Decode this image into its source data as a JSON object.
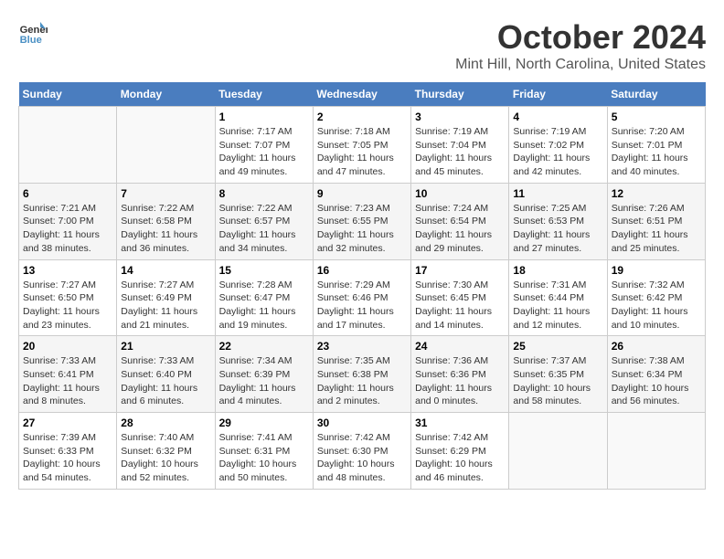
{
  "header": {
    "logo_line1": "General",
    "logo_line2": "Blue",
    "month": "October 2024",
    "location": "Mint Hill, North Carolina, United States"
  },
  "days_of_week": [
    "Sunday",
    "Monday",
    "Tuesday",
    "Wednesday",
    "Thursday",
    "Friday",
    "Saturday"
  ],
  "weeks": [
    [
      {
        "day": "",
        "sunrise": "",
        "sunset": "",
        "daylight": ""
      },
      {
        "day": "",
        "sunrise": "",
        "sunset": "",
        "daylight": ""
      },
      {
        "day": "1",
        "sunrise": "Sunrise: 7:17 AM",
        "sunset": "Sunset: 7:07 PM",
        "daylight": "Daylight: 11 hours and 49 minutes."
      },
      {
        "day": "2",
        "sunrise": "Sunrise: 7:18 AM",
        "sunset": "Sunset: 7:05 PM",
        "daylight": "Daylight: 11 hours and 47 minutes."
      },
      {
        "day": "3",
        "sunrise": "Sunrise: 7:19 AM",
        "sunset": "Sunset: 7:04 PM",
        "daylight": "Daylight: 11 hours and 45 minutes."
      },
      {
        "day": "4",
        "sunrise": "Sunrise: 7:19 AM",
        "sunset": "Sunset: 7:02 PM",
        "daylight": "Daylight: 11 hours and 42 minutes."
      },
      {
        "day": "5",
        "sunrise": "Sunrise: 7:20 AM",
        "sunset": "Sunset: 7:01 PM",
        "daylight": "Daylight: 11 hours and 40 minutes."
      }
    ],
    [
      {
        "day": "6",
        "sunrise": "Sunrise: 7:21 AM",
        "sunset": "Sunset: 7:00 PM",
        "daylight": "Daylight: 11 hours and 38 minutes."
      },
      {
        "day": "7",
        "sunrise": "Sunrise: 7:22 AM",
        "sunset": "Sunset: 6:58 PM",
        "daylight": "Daylight: 11 hours and 36 minutes."
      },
      {
        "day": "8",
        "sunrise": "Sunrise: 7:22 AM",
        "sunset": "Sunset: 6:57 PM",
        "daylight": "Daylight: 11 hours and 34 minutes."
      },
      {
        "day": "9",
        "sunrise": "Sunrise: 7:23 AM",
        "sunset": "Sunset: 6:55 PM",
        "daylight": "Daylight: 11 hours and 32 minutes."
      },
      {
        "day": "10",
        "sunrise": "Sunrise: 7:24 AM",
        "sunset": "Sunset: 6:54 PM",
        "daylight": "Daylight: 11 hours and 29 minutes."
      },
      {
        "day": "11",
        "sunrise": "Sunrise: 7:25 AM",
        "sunset": "Sunset: 6:53 PM",
        "daylight": "Daylight: 11 hours and 27 minutes."
      },
      {
        "day": "12",
        "sunrise": "Sunrise: 7:26 AM",
        "sunset": "Sunset: 6:51 PM",
        "daylight": "Daylight: 11 hours and 25 minutes."
      }
    ],
    [
      {
        "day": "13",
        "sunrise": "Sunrise: 7:27 AM",
        "sunset": "Sunset: 6:50 PM",
        "daylight": "Daylight: 11 hours and 23 minutes."
      },
      {
        "day": "14",
        "sunrise": "Sunrise: 7:27 AM",
        "sunset": "Sunset: 6:49 PM",
        "daylight": "Daylight: 11 hours and 21 minutes."
      },
      {
        "day": "15",
        "sunrise": "Sunrise: 7:28 AM",
        "sunset": "Sunset: 6:47 PM",
        "daylight": "Daylight: 11 hours and 19 minutes."
      },
      {
        "day": "16",
        "sunrise": "Sunrise: 7:29 AM",
        "sunset": "Sunset: 6:46 PM",
        "daylight": "Daylight: 11 hours and 17 minutes."
      },
      {
        "day": "17",
        "sunrise": "Sunrise: 7:30 AM",
        "sunset": "Sunset: 6:45 PM",
        "daylight": "Daylight: 11 hours and 14 minutes."
      },
      {
        "day": "18",
        "sunrise": "Sunrise: 7:31 AM",
        "sunset": "Sunset: 6:44 PM",
        "daylight": "Daylight: 11 hours and 12 minutes."
      },
      {
        "day": "19",
        "sunrise": "Sunrise: 7:32 AM",
        "sunset": "Sunset: 6:42 PM",
        "daylight": "Daylight: 11 hours and 10 minutes."
      }
    ],
    [
      {
        "day": "20",
        "sunrise": "Sunrise: 7:33 AM",
        "sunset": "Sunset: 6:41 PM",
        "daylight": "Daylight: 11 hours and 8 minutes."
      },
      {
        "day": "21",
        "sunrise": "Sunrise: 7:33 AM",
        "sunset": "Sunset: 6:40 PM",
        "daylight": "Daylight: 11 hours and 6 minutes."
      },
      {
        "day": "22",
        "sunrise": "Sunrise: 7:34 AM",
        "sunset": "Sunset: 6:39 PM",
        "daylight": "Daylight: 11 hours and 4 minutes."
      },
      {
        "day": "23",
        "sunrise": "Sunrise: 7:35 AM",
        "sunset": "Sunset: 6:38 PM",
        "daylight": "Daylight: 11 hours and 2 minutes."
      },
      {
        "day": "24",
        "sunrise": "Sunrise: 7:36 AM",
        "sunset": "Sunset: 6:36 PM",
        "daylight": "Daylight: 11 hours and 0 minutes."
      },
      {
        "day": "25",
        "sunrise": "Sunrise: 7:37 AM",
        "sunset": "Sunset: 6:35 PM",
        "daylight": "Daylight: 10 hours and 58 minutes."
      },
      {
        "day": "26",
        "sunrise": "Sunrise: 7:38 AM",
        "sunset": "Sunset: 6:34 PM",
        "daylight": "Daylight: 10 hours and 56 minutes."
      }
    ],
    [
      {
        "day": "27",
        "sunrise": "Sunrise: 7:39 AM",
        "sunset": "Sunset: 6:33 PM",
        "daylight": "Daylight: 10 hours and 54 minutes."
      },
      {
        "day": "28",
        "sunrise": "Sunrise: 7:40 AM",
        "sunset": "Sunset: 6:32 PM",
        "daylight": "Daylight: 10 hours and 52 minutes."
      },
      {
        "day": "29",
        "sunrise": "Sunrise: 7:41 AM",
        "sunset": "Sunset: 6:31 PM",
        "daylight": "Daylight: 10 hours and 50 minutes."
      },
      {
        "day": "30",
        "sunrise": "Sunrise: 7:42 AM",
        "sunset": "Sunset: 6:30 PM",
        "daylight": "Daylight: 10 hours and 48 minutes."
      },
      {
        "day": "31",
        "sunrise": "Sunrise: 7:42 AM",
        "sunset": "Sunset: 6:29 PM",
        "daylight": "Daylight: 10 hours and 46 minutes."
      },
      {
        "day": "",
        "sunrise": "",
        "sunset": "",
        "daylight": ""
      },
      {
        "day": "",
        "sunrise": "",
        "sunset": "",
        "daylight": ""
      }
    ]
  ]
}
